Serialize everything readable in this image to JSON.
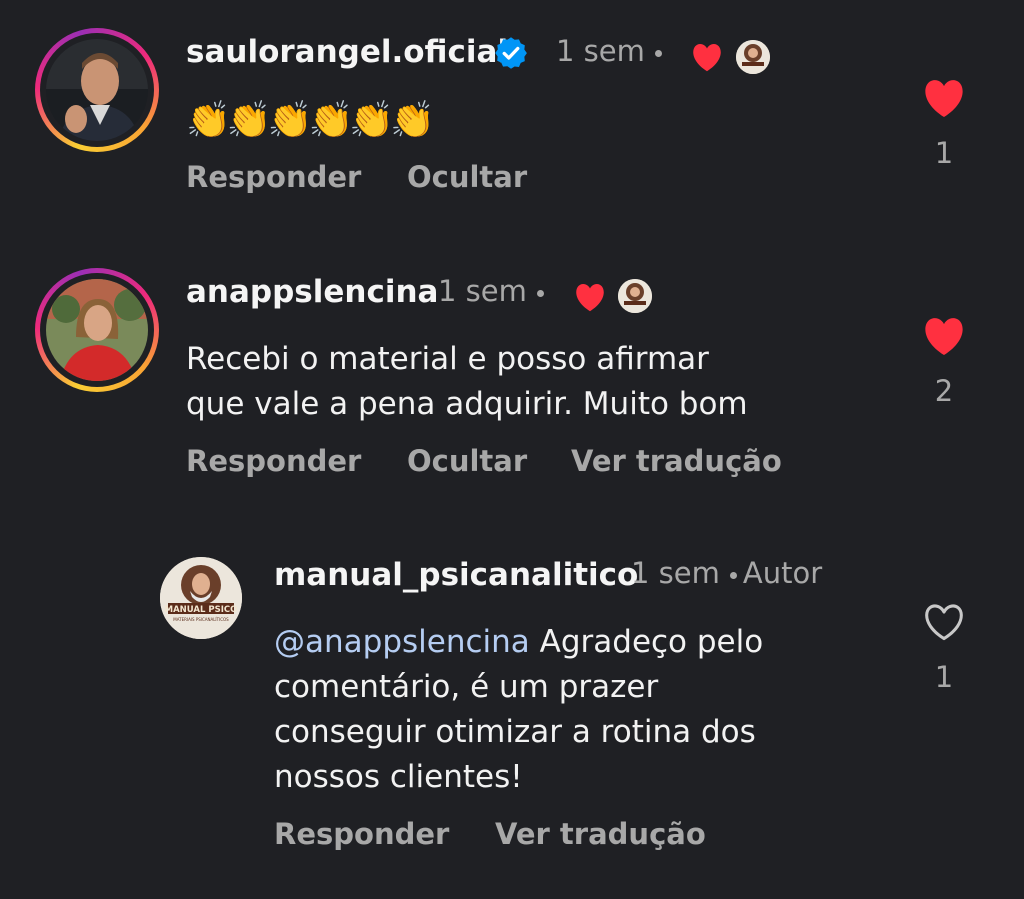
{
  "colors": {
    "background": "#1f2024",
    "heart_red": "#ff3040",
    "verified_blue": "#0095f6",
    "mention_blue": "#b5cdf2",
    "muted": "#a8a8a8"
  },
  "comments": [
    {
      "username": "saulorangel.oficial",
      "verified": true,
      "time": "1 sem",
      "liked_by_author": true,
      "text": "👏👏👏👏👏👏",
      "actions": [
        "Responder",
        "Ocultar"
      ],
      "liked": true,
      "like_count": "1"
    },
    {
      "username": "anappslencina",
      "verified": false,
      "time": "1 sem",
      "liked_by_author": true,
      "text_lines": [
        "Recebi o material e posso afirmar",
        "que vale a pena adquirir. Muito bom"
      ],
      "actions": [
        "Responder",
        "Ocultar",
        "Ver tradução"
      ],
      "liked": true,
      "like_count": "2"
    },
    {
      "username": "manual_psicanalitico",
      "time": "1 sem",
      "author_badge": "Autor",
      "avatar_text": "MANUAL PSICO",
      "avatar_subtext": "MATERIAIS PSICANALÍTICOS",
      "mention": "@anappslencina",
      "text_after_mention": " Agradeço pelo",
      "text_lines": [
        "comentário, é um prazer",
        "conseguir otimizar a rotina dos",
        "nossos clientes!"
      ],
      "actions": [
        "Responder",
        "Ver tradução"
      ],
      "liked": false,
      "like_count": "1"
    }
  ]
}
